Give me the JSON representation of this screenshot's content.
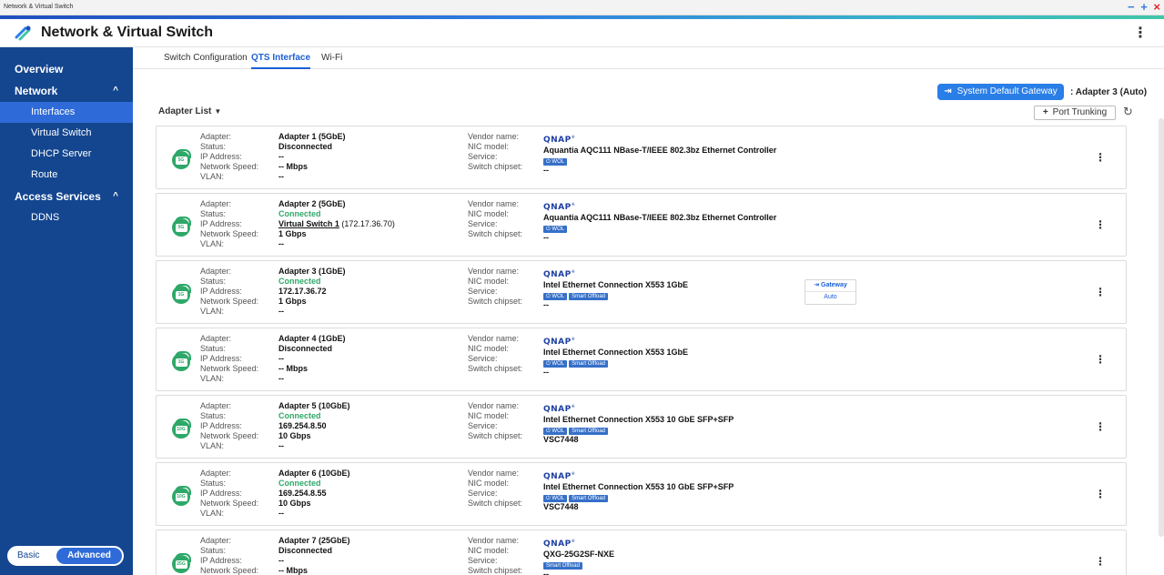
{
  "window": {
    "title": "Network & Virtual Switch",
    "controls": [
      "−",
      "+",
      "×"
    ]
  },
  "header": {
    "title": "Network & Virtual Switch"
  },
  "sidebar": {
    "overview": "Overview",
    "network": {
      "label": "Network",
      "chevron": "^",
      "items": [
        "Interfaces",
        "Virtual Switch",
        "DHCP Server",
        "Route"
      ]
    },
    "access": {
      "label": "Access Services",
      "chevron": "^",
      "items": [
        "DDNS"
      ]
    },
    "mode": {
      "basic": "Basic",
      "advanced": "Advanced"
    }
  },
  "tabs": [
    "Switch Configuration",
    "QTS Interface",
    "Wi-Fi"
  ],
  "active_tab": "QTS Interface",
  "toolbar": {
    "gateway_button": "System Default Gateway",
    "gateway_value": ": Adapter 3 (Auto)",
    "adapter_list": "Adapter List",
    "port_trunking": "Port Trunking"
  },
  "field_labels": {
    "adapter": "Adapter:",
    "status": "Status:",
    "ip": "IP Address:",
    "speed": "Network Speed:",
    "vlan": "VLAN:",
    "vendor": "Vendor name:",
    "nic": "NIC model:",
    "service": "Service:",
    "chipset": "Switch chipset:"
  },
  "vendor_logo": "QNAP",
  "gateway_tag": {
    "label": "Gateway",
    "mode": "Auto"
  },
  "adapters": [
    {
      "badge": "5G",
      "name": "Adapter 1 (5GbE)",
      "status": "Disconnected",
      "ip": "--",
      "ip_extra": "",
      "speed": "-- Mbps",
      "vlan": "--",
      "nic": "Aquantia AQC111 NBase-T/IEEE 802.3bz Ethernet Controller",
      "service": [
        "WOL"
      ],
      "chipset": "--"
    },
    {
      "badge": "5G",
      "name": "Adapter 2 (5GbE)",
      "status": "Connected",
      "ip": "Virtual Switch 1",
      "ip_extra": " (172.17.36.70)",
      "speed": "1 Gbps",
      "vlan": "--",
      "nic": "Aquantia AQC111 NBase-T/IEEE 802.3bz Ethernet Controller",
      "service": [
        "WOL"
      ],
      "chipset": "--"
    },
    {
      "badge": "1G",
      "name": "Adapter 3 (1GbE)",
      "status": "Connected",
      "ip": "172.17.36.72",
      "ip_extra": "",
      "speed": "1 Gbps",
      "vlan": "--",
      "nic": "Intel Ethernet Connection X553 1GbE",
      "service": [
        "WOL",
        "Smart Offload"
      ],
      "chipset": "--"
    },
    {
      "badge": "1G",
      "name": "Adapter 4 (1GbE)",
      "status": "Disconnected",
      "ip": "--",
      "ip_extra": "",
      "speed": "-- Mbps",
      "vlan": "--",
      "nic": "Intel Ethernet Connection X553 1GbE",
      "service": [
        "WOL",
        "Smart Offload"
      ],
      "chipset": "--"
    },
    {
      "badge": "10G",
      "name": "Adapter 5 (10GbE)",
      "status": "Connected",
      "ip": "169.254.8.50",
      "ip_extra": "",
      "speed": "10 Gbps",
      "vlan": "--",
      "nic": "Intel Ethernet Connection X553 10 GbE SFP+SFP",
      "service": [
        "WOL",
        "Smart Offload"
      ],
      "chipset": "VSC7448"
    },
    {
      "badge": "10G",
      "name": "Adapter 6 (10GbE)",
      "status": "Connected",
      "ip": "169.254.8.55",
      "ip_extra": "",
      "speed": "10 Gbps",
      "vlan": "--",
      "nic": "Intel Ethernet Connection X553 10 GbE SFP+SFP",
      "service": [
        "WOL",
        "Smart Offload"
      ],
      "chipset": "VSC7448"
    },
    {
      "badge": "25G",
      "name": "Adapter 7 (25GbE)",
      "status": "Disconnected",
      "ip": "--",
      "ip_extra": "",
      "speed": "-- Mbps",
      "vlan": "--",
      "nic": "QXG-25G2SF-NXE",
      "service": [
        "Smart Offload"
      ],
      "chipset": "--"
    }
  ],
  "colors": {
    "sidebar": "#14468f",
    "active_item": "#2e6bd8",
    "connected": "#2ea869",
    "accent": "#2a7ee8"
  }
}
